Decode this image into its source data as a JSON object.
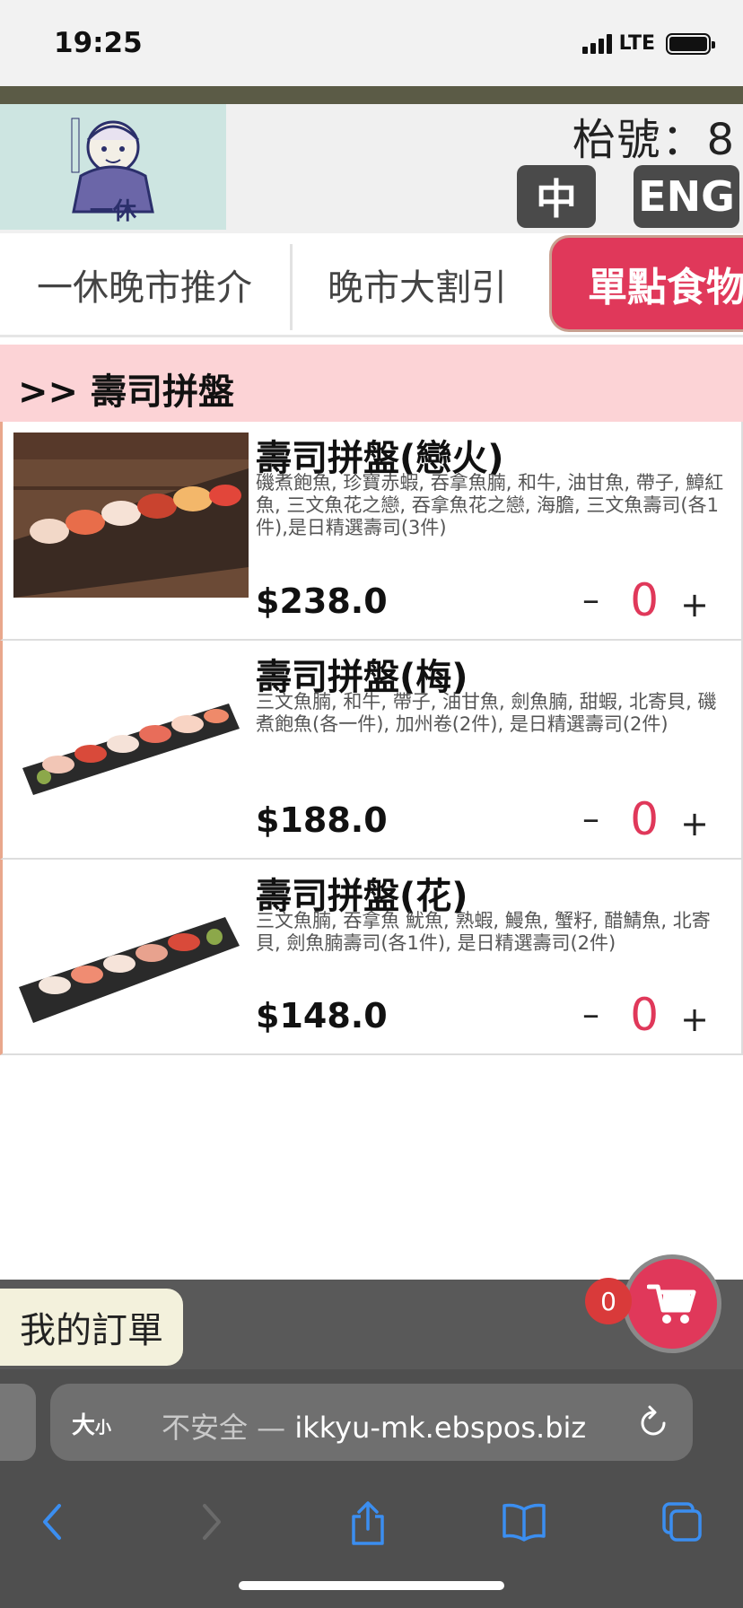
{
  "status": {
    "time": "19:25",
    "network": "LTE"
  },
  "header": {
    "table_no": "枱號：8",
    "lang_zh": "中",
    "lang_en": "ENG",
    "logo_name": "ikkyu-logo"
  },
  "tabs": [
    {
      "label": "一休晚市推介"
    },
    {
      "label": "晚市大割引"
    },
    {
      "label": "單點食物",
      "active": true
    }
  ],
  "category": {
    "title": ">> 壽司拼盤"
  },
  "items": [
    {
      "name": "壽司拼盤(戀火)",
      "desc": "磯煮飽魚, 珍寶赤蝦, 吞拿魚腩, 和牛, 油甘魚, 帶子, 鱆紅魚, 三文魚花之戀, 吞拿魚花之戀, 海膽, 三文魚壽司(各1件),是日精選壽司(3件)",
      "price": "$238.0",
      "qty": "0"
    },
    {
      "name": "壽司拼盤(梅)",
      "desc": "三文魚腩, 和牛, 帶子, 油甘魚, 劍魚腩, 甜蝦, 北寄貝, 磯煮飽魚(各一件), 加州卷(2件), 是日精選壽司(2件)",
      "price": "$188.0",
      "qty": "0"
    },
    {
      "name": "壽司拼盤(花)",
      "desc": "三文魚腩, 吞拿魚 魷魚, 熟蝦, 鰻魚, 蟹籽, 醋鯖魚, 北寄貝, 劍魚腩壽司(各1件), 是日精選壽司(2件)",
      "price": "$148.0",
      "qty": "0"
    }
  ],
  "qty_controls": {
    "minus": "–",
    "plus": "+"
  },
  "order": {
    "label": "我的訂單",
    "cart_count": "0"
  },
  "browser": {
    "text_size_big": "大",
    "text_size_small": "小",
    "insecure": "不安全 — ",
    "domain": "ikkyu-mk.ebspos.biz"
  },
  "colors": {
    "accent": "#e0385a",
    "category_bg": "#fcd3d6",
    "olive": "#5b5b46"
  }
}
